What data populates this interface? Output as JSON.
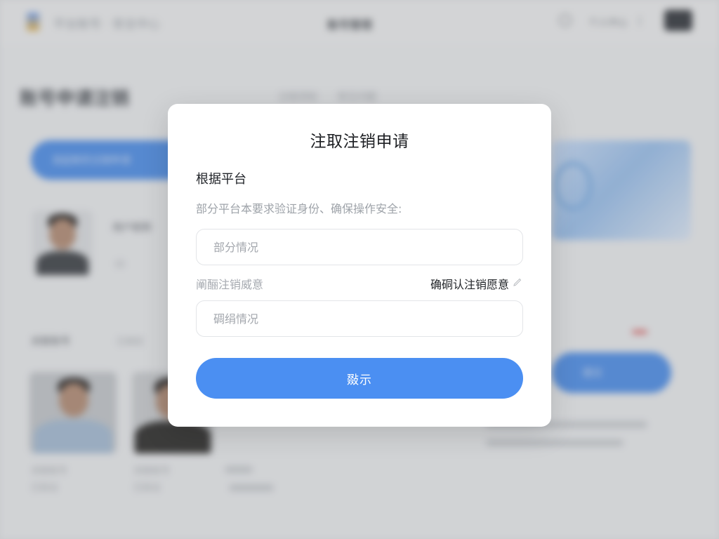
{
  "background": {
    "brand_text": "平台账号 · 安全中心",
    "center_title": "账号管理",
    "nav_text": "个人中心",
    "heading": "账号申请注销",
    "primary_button": "发起新的注销申请",
    "tabs": [
      "注销须知",
      "常见问题"
    ],
    "profile_name": "用户昵称",
    "profile_meta": "ID",
    "list_label": "关联账号",
    "list_label_2": "已绑定",
    "cards": [
      {
        "name": "关联账号",
        "meta": "已验证"
      },
      {
        "name": "关联账号",
        "meta": "已验证"
      }
    ],
    "right_button": "提交"
  },
  "modal": {
    "title": "注取注销申请",
    "section_label": "根据平台",
    "description": "部分平台本要求验证身份、确保操作安全:",
    "input1_placeholder": "部分情况",
    "row_left_label": "阐酾注销威意",
    "row_right_link": "确硐认注销愿意",
    "input2_placeholder": "碉绢情况",
    "submit_label": "敠示"
  },
  "colors": {
    "accent": "#4b8ff2",
    "overlay": "rgba(120,122,126,0.28)"
  },
  "icons": {
    "row_right": "edit-pencil-icon"
  }
}
